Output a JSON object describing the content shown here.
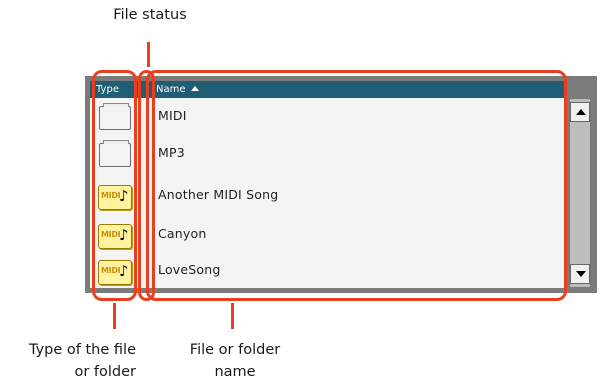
{
  "callouts": {
    "file_status": "File status",
    "type_line1": "Type of the file",
    "type_line2": "or folder",
    "name_line1": "File or folder",
    "name_line2": "name"
  },
  "browser": {
    "columns": {
      "type": "Type",
      "name": "Name"
    },
    "sort": "ascending",
    "rows": [
      {
        "name": "MIDI",
        "icon": "folder-icon"
      },
      {
        "name": "MP3",
        "icon": "folder-icon"
      },
      {
        "name": "Another MIDI Song",
        "icon": "midi-file-icon",
        "icon_text": "MIDI"
      },
      {
        "name": "Canyon",
        "icon": "midi-file-icon",
        "icon_text": "MIDI"
      },
      {
        "name": "LoveSong",
        "icon": "midi-file-icon",
        "icon_text": "MIDI"
      }
    ]
  },
  "colors": {
    "header": "#215d74",
    "highlight": "#e8401f",
    "list_bg": "#f4f4f4",
    "frame": "#7b7b7b"
  }
}
